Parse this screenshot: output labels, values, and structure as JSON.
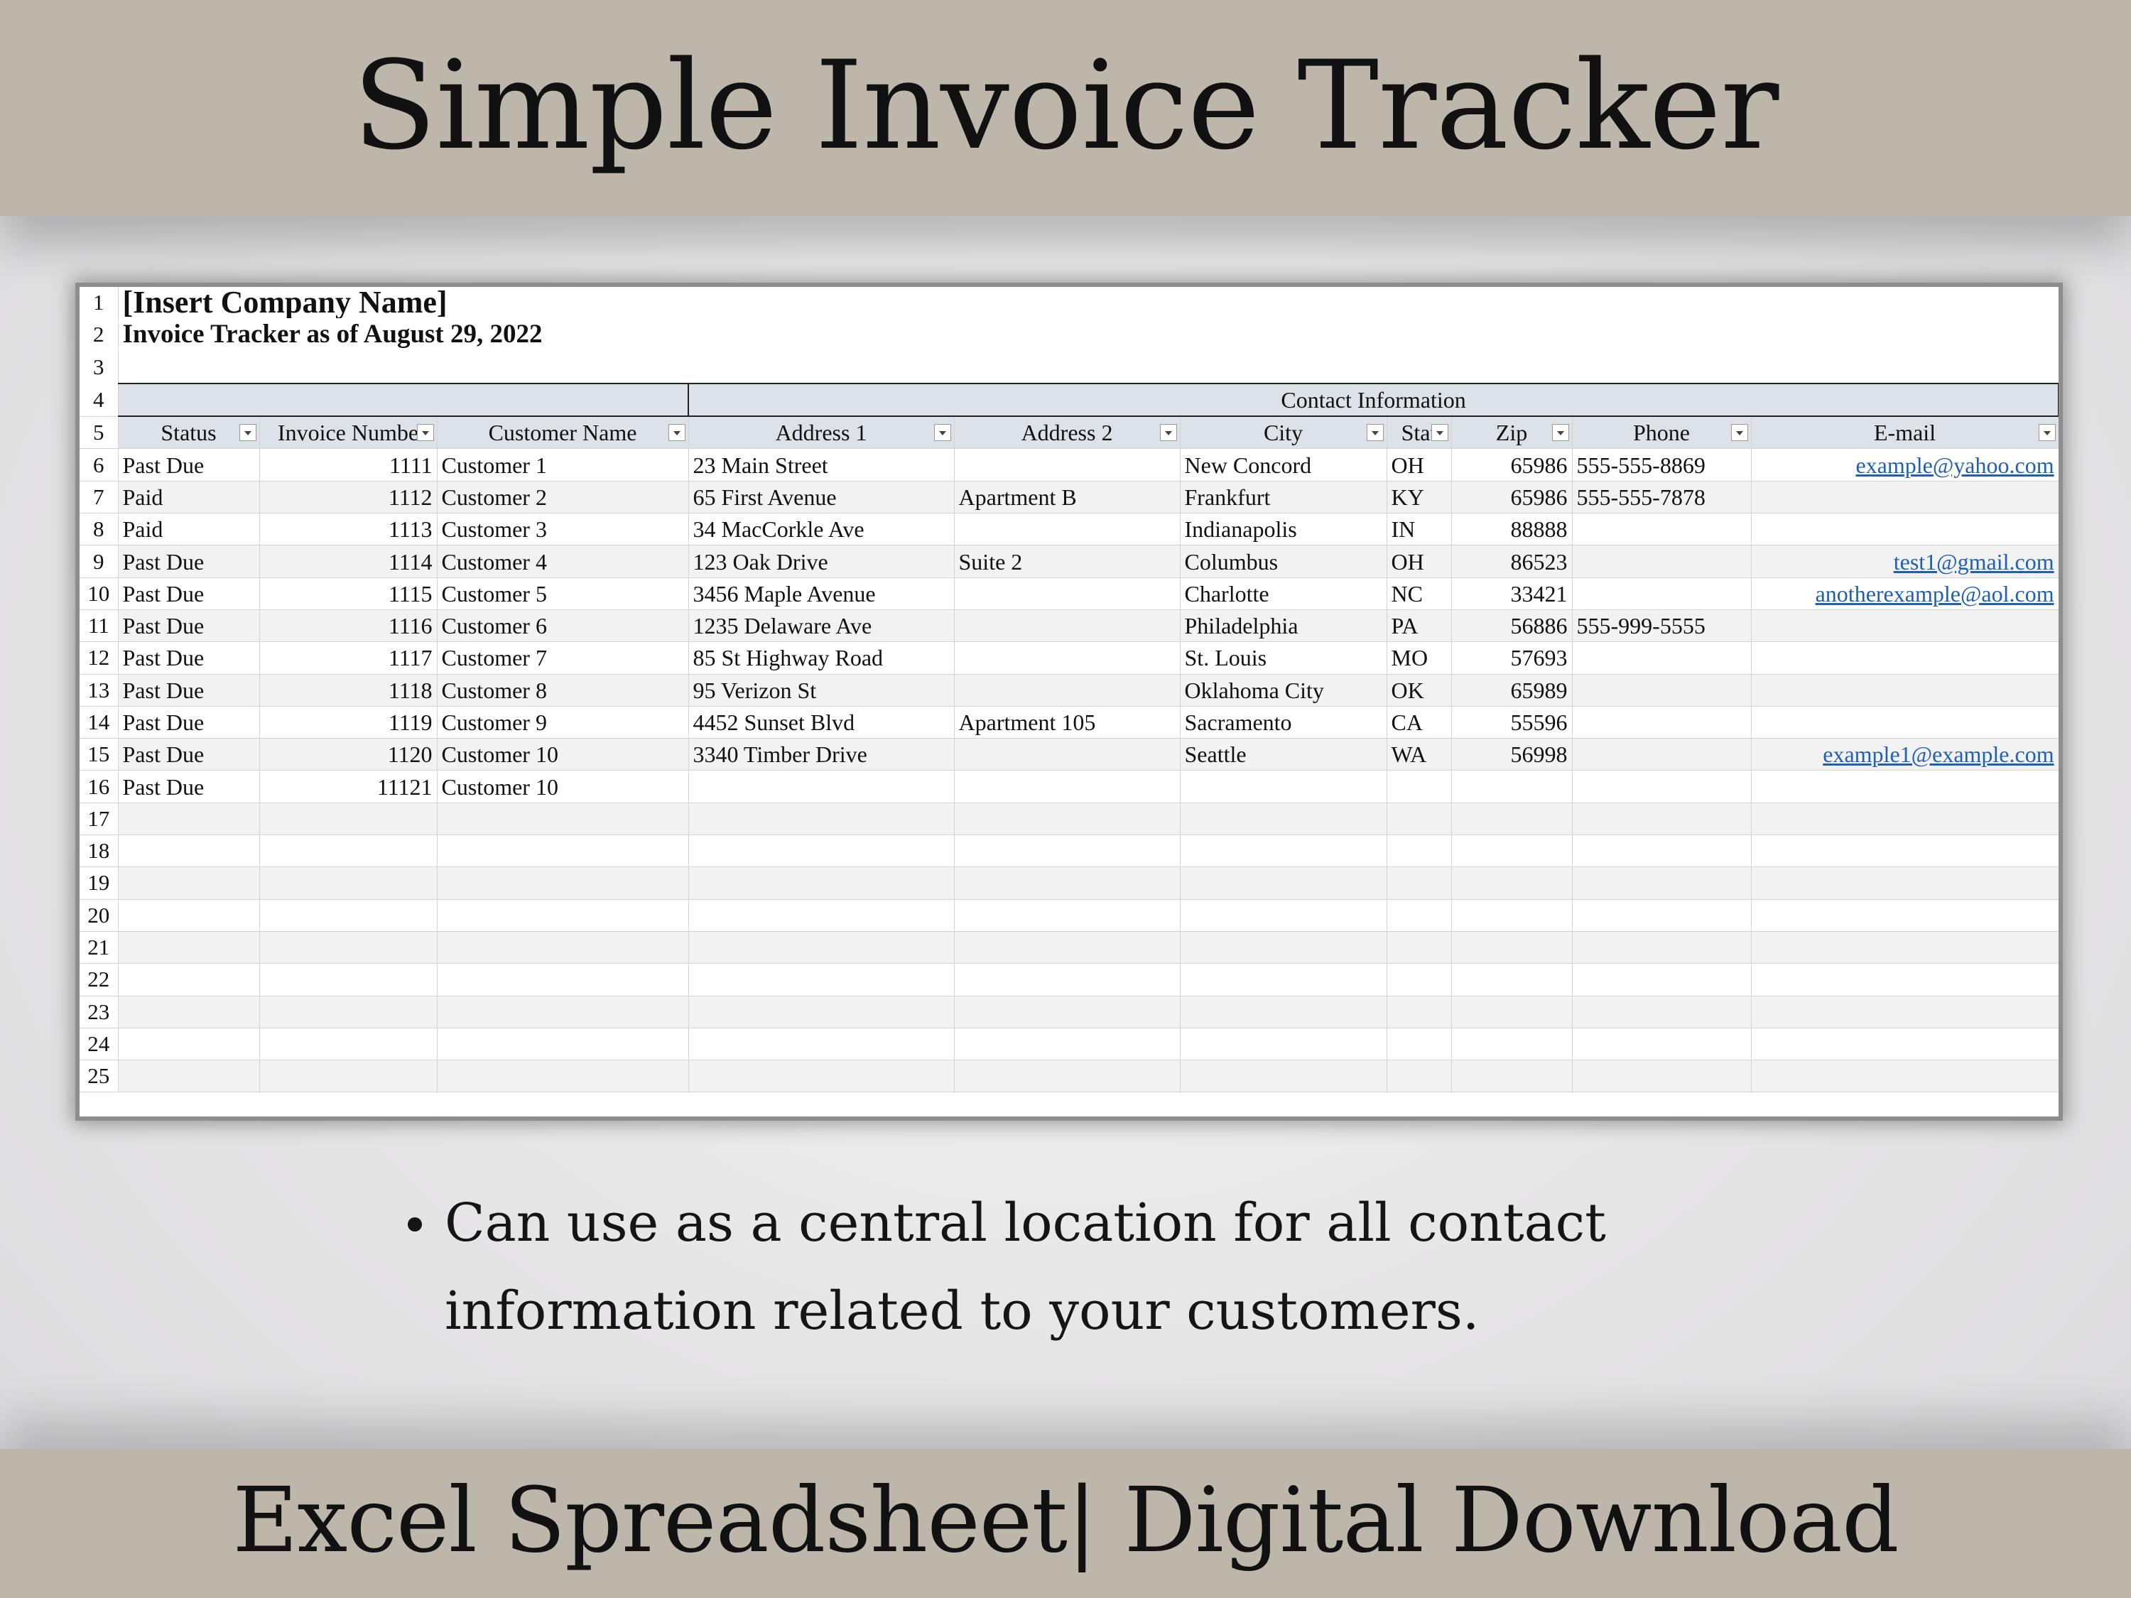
{
  "header": {
    "title": "Simple Invoice Tracker"
  },
  "footer": {
    "text": "Excel Spreadsheet| Digital Download"
  },
  "bullet": {
    "text": "Can use as a central location for all contact information related to your customers."
  },
  "sheet": {
    "company_name": "[Insert Company Name]",
    "subtitle": "Invoice Tracker as of August 29, 2022",
    "group_header": "Contact Information",
    "row_numbers": [
      "1",
      "2",
      "3",
      "4",
      "5",
      "6",
      "7",
      "8",
      "9",
      "10",
      "11",
      "12",
      "13",
      "14",
      "15",
      "16",
      "17",
      "18",
      "19",
      "20",
      "21",
      "22",
      "23",
      "24",
      "25"
    ],
    "columns": [
      "Status",
      "Invoice Numbe",
      "Customer Name",
      "Address 1",
      "Address 2",
      "City",
      "Stat",
      "Zip",
      "Phone",
      "E-mail"
    ],
    "rows": [
      [
        "Past Due",
        "1111",
        "Customer 1",
        "23 Main Street",
        "",
        "New Concord",
        "OH",
        "65986",
        "555-555-8869",
        "example@yahoo.com"
      ],
      [
        "Paid",
        "1112",
        "Customer 2",
        "65 First Avenue",
        "Apartment B",
        "Frankfurt",
        "KY",
        "65986",
        "555-555-7878",
        ""
      ],
      [
        "Paid",
        "1113",
        "Customer 3",
        "34 MacCorkle Ave",
        "",
        "Indianapolis",
        "IN",
        "88888",
        "",
        ""
      ],
      [
        "Past Due",
        "1114",
        "Customer 4",
        "123 Oak Drive",
        "Suite 2",
        "Columbus",
        "OH",
        "86523",
        "",
        "test1@gmail.com"
      ],
      [
        "Past Due",
        "1115",
        "Customer 5",
        "3456 Maple Avenue",
        "",
        "Charlotte",
        "NC",
        "33421",
        "",
        "anotherexample@aol.com"
      ],
      [
        "Past Due",
        "1116",
        "Customer 6",
        "1235 Delaware Ave",
        "",
        "Philadelphia",
        "PA",
        "56886",
        "555-999-5555",
        ""
      ],
      [
        "Past Due",
        "1117",
        "Customer 7",
        "85 St Highway Road",
        "",
        "St. Louis",
        "MO",
        "57693",
        "",
        ""
      ],
      [
        "Past Due",
        "1118",
        "Customer 8",
        "95 Verizon St",
        "",
        "Oklahoma City",
        "OK",
        "65989",
        "",
        ""
      ],
      [
        "Past Due",
        "1119",
        "Customer 9",
        "4452 Sunset Blvd",
        "Apartment 105",
        "Sacramento",
        "CA",
        "55596",
        "",
        ""
      ],
      [
        "Past Due",
        "1120",
        "Customer 10",
        "3340 Timber Drive",
        "",
        "Seattle",
        "WA",
        "56998",
        "",
        "example1@example.com"
      ],
      [
        "Past Due",
        "11121",
        "Customer 10",
        "",
        "",
        "",
        "",
        "",
        "",
        ""
      ]
    ]
  }
}
